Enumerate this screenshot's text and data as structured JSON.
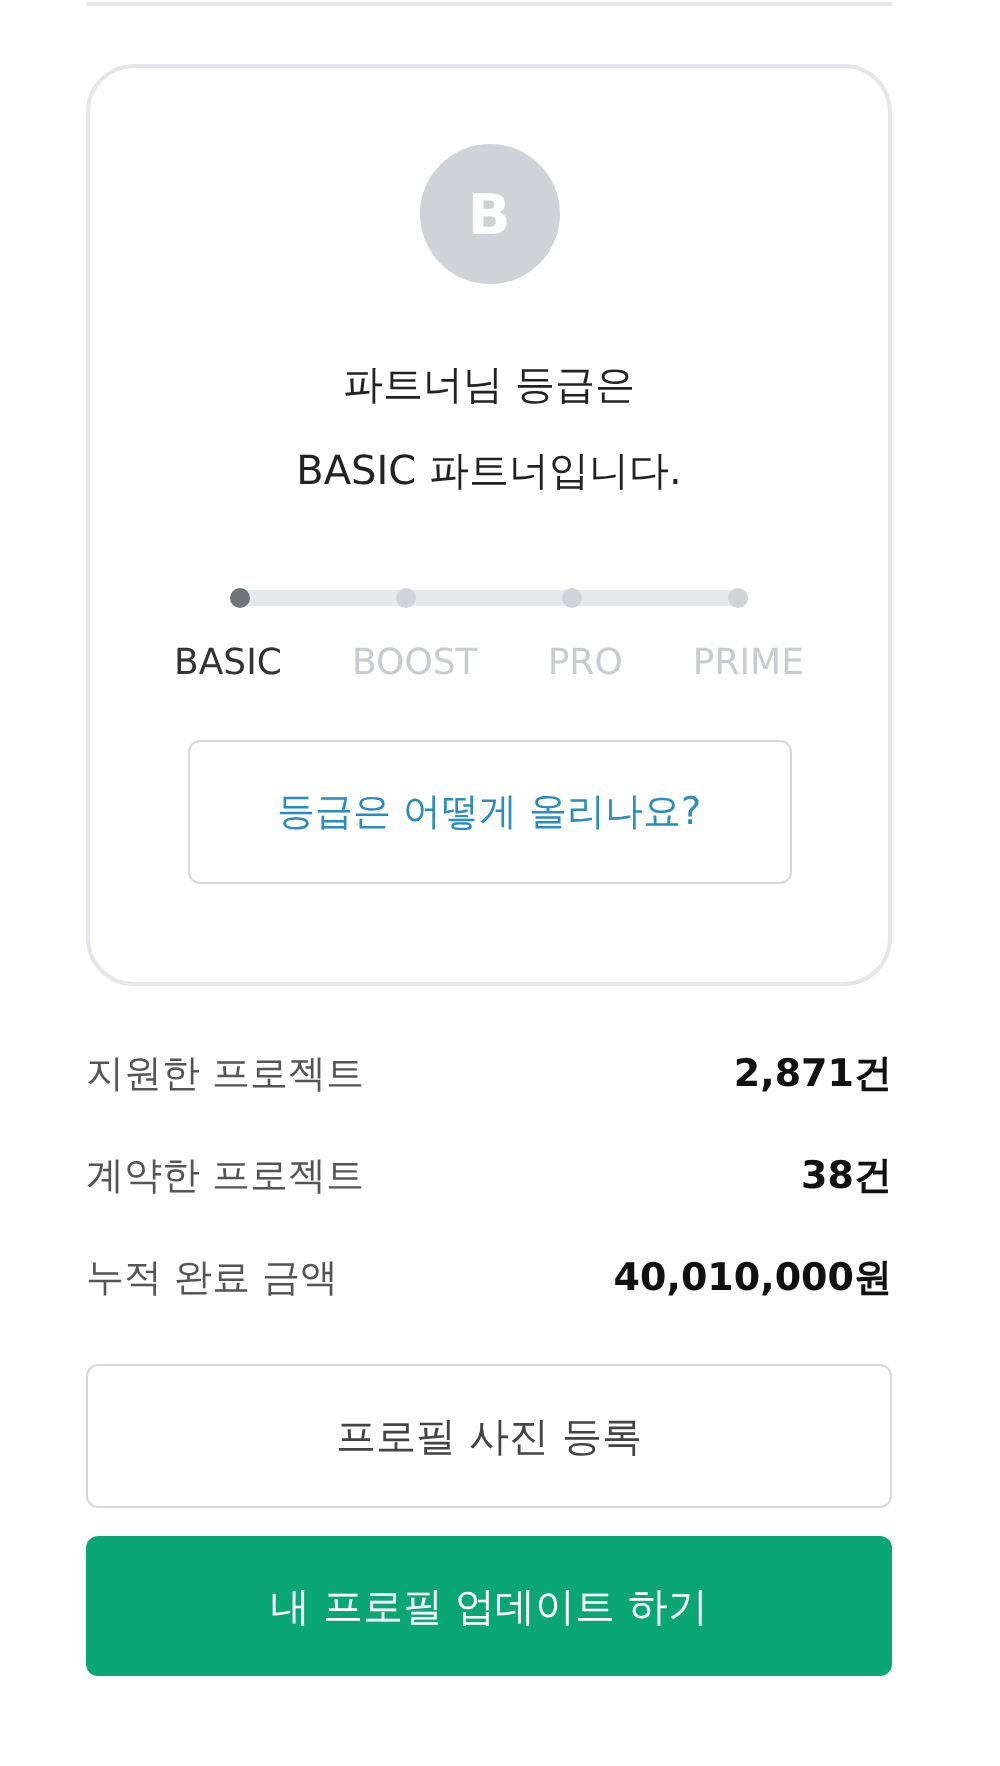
{
  "grade_card": {
    "avatar_letter": "B",
    "title_lines": [
      "파트너님 등급은",
      "BASIC 파트너입니다."
    ],
    "grades": [
      {
        "label": "BASIC",
        "selected": true
      },
      {
        "label": "BOOST",
        "selected": false
      },
      {
        "label": "PRO",
        "selected": false
      },
      {
        "label": "PRIME",
        "selected": false
      }
    ],
    "help_button": "등급은 어떻게 올리나요?"
  },
  "stats": [
    {
      "label": "지원한 프로젝트",
      "value": "2,871건"
    },
    {
      "label": "계약한 프로젝트",
      "value": "38건"
    },
    {
      "label": "누적 완료 금액",
      "value": "40,010,000원"
    }
  ],
  "buttons": [
    {
      "kind": "outline",
      "label": "프로필 사진 등록"
    },
    {
      "kind": "primary",
      "label": "내 프로필 업데이트 하기"
    }
  ]
}
